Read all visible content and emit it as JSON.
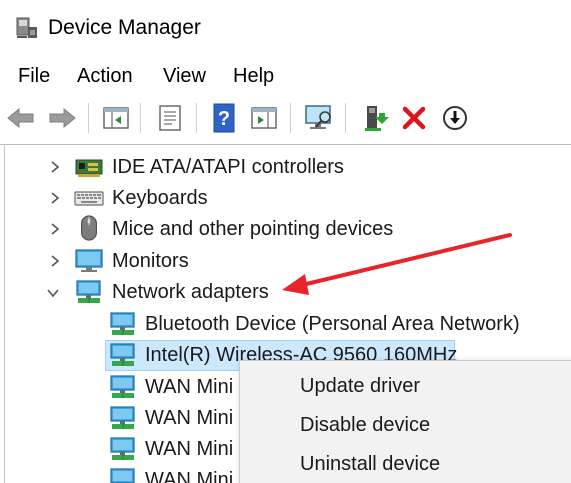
{
  "window": {
    "title": "Device Manager"
  },
  "menu": {
    "items": [
      "File",
      "Action",
      "View",
      "Help"
    ]
  },
  "toolbar": {
    "buttons": [
      "back-icon",
      "forward-icon",
      "show-hide-console-tree-icon",
      "properties-icon",
      "help-icon",
      "action-pane-icon",
      "scan-hardware-icon",
      "update-driver-icon",
      "uninstall-icon",
      "disable-icon"
    ]
  },
  "tree": {
    "categories": [
      {
        "label": "IDE ATA/ATAPI controllers",
        "expanded": false,
        "icon": "ide-controller-icon"
      },
      {
        "label": "Keyboards",
        "expanded": false,
        "icon": "keyboard-icon"
      },
      {
        "label": "Mice and other pointing devices",
        "expanded": false,
        "icon": "mouse-icon"
      },
      {
        "label": "Monitors",
        "expanded": false,
        "icon": "monitor-icon"
      },
      {
        "label": "Network adapters",
        "expanded": true,
        "icon": "network-adapter-icon"
      }
    ],
    "network_children": [
      {
        "label": "Bluetooth Device (Personal Area Network)"
      },
      {
        "label": "Intel(R) Wireless-AC 9560 160MHz",
        "selected": true
      },
      {
        "label": "WAN Mini"
      },
      {
        "label": "WAN Mini"
      },
      {
        "label": "WAN Mini"
      },
      {
        "label": "WAN Mini"
      }
    ]
  },
  "context_menu": {
    "items": [
      "Update driver",
      "Disable device",
      "Uninstall device"
    ]
  },
  "colors": {
    "selection": "#cce8ff",
    "annotation_arrow": "#e8232a",
    "uninstall_red": "#e0131a"
  }
}
